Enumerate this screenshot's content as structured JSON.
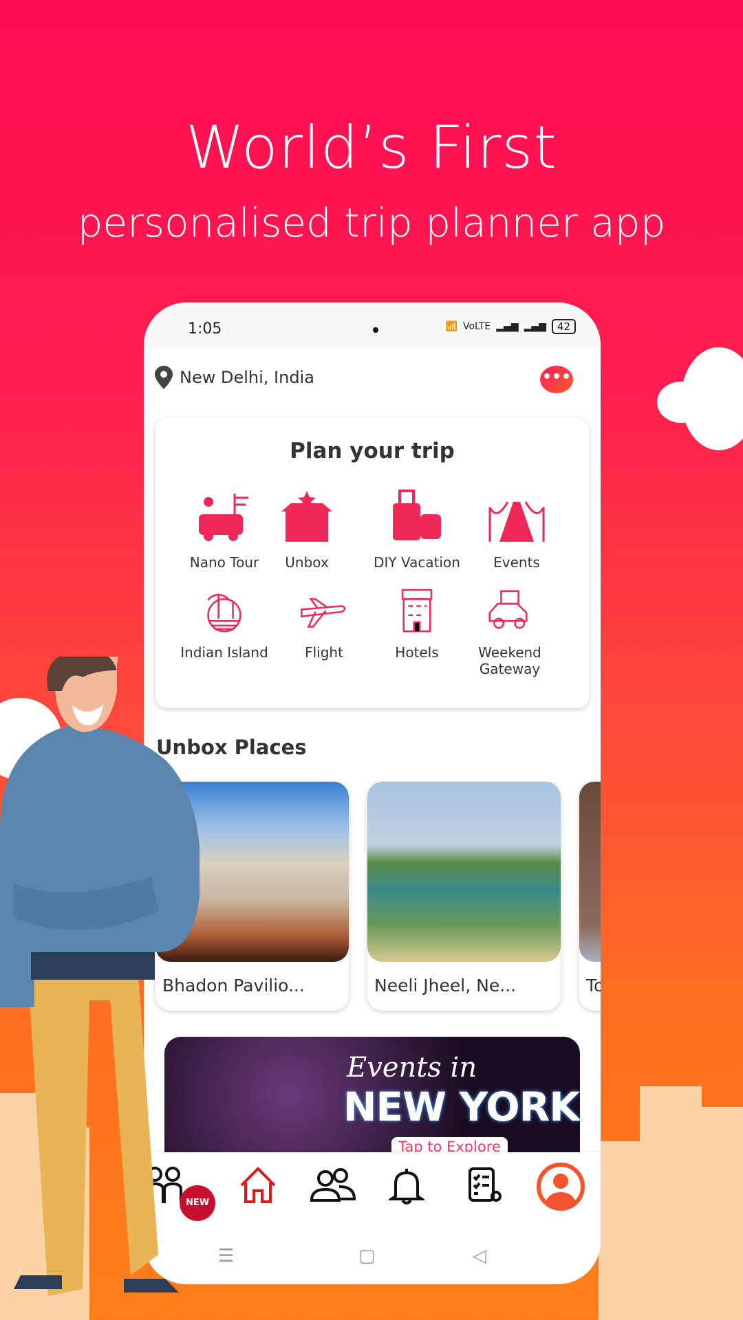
{
  "hero": {
    "title": "World’s First",
    "subtitle": "personalised trip planner app"
  },
  "status_bar": {
    "time": "1:05",
    "network": "VoLTE",
    "battery": "42"
  },
  "location": {
    "label": "New Delhi, India",
    "icon": "map-pin-icon"
  },
  "chat_icon": "chat-bubble-icon",
  "plan": {
    "title": "Plan your trip",
    "items": [
      {
        "label": "Nano Tour",
        "icon": "van-icon"
      },
      {
        "label": "Unbox",
        "icon": "gift-box-icon"
      },
      {
        "label": "DIY Vacation",
        "icon": "luggage-icon"
      },
      {
        "label": "Events",
        "icon": "red-carpet-icon"
      },
      {
        "label": "Indian Island",
        "icon": "island-icon"
      },
      {
        "label": "Flight",
        "icon": "plane-icon"
      },
      {
        "label": "Hotels",
        "icon": "hotel-icon"
      },
      {
        "label": "Weekend Gateway",
        "icon": "car-luggage-icon"
      }
    ]
  },
  "unbox": {
    "title": "Unbox Places",
    "places": [
      {
        "name": "Bhadon Pavilio..."
      },
      {
        "name": "Neeli Jheel, Ne..."
      },
      {
        "name": "To"
      }
    ]
  },
  "banner": {
    "line1": "Events in",
    "line2": "NEW YORK",
    "cta": "Tap to Explore"
  },
  "nav": {
    "badge": "NEW",
    "items": [
      "community-icon",
      "home-icon",
      "people-icon",
      "bell-icon",
      "itinerary-icon",
      "profile-icon"
    ]
  },
  "colors": {
    "accent": "#f0285a",
    "gradient_top": "#ff0a54",
    "gradient_bottom": "#ff7f1a",
    "profile": "#f5522e"
  }
}
